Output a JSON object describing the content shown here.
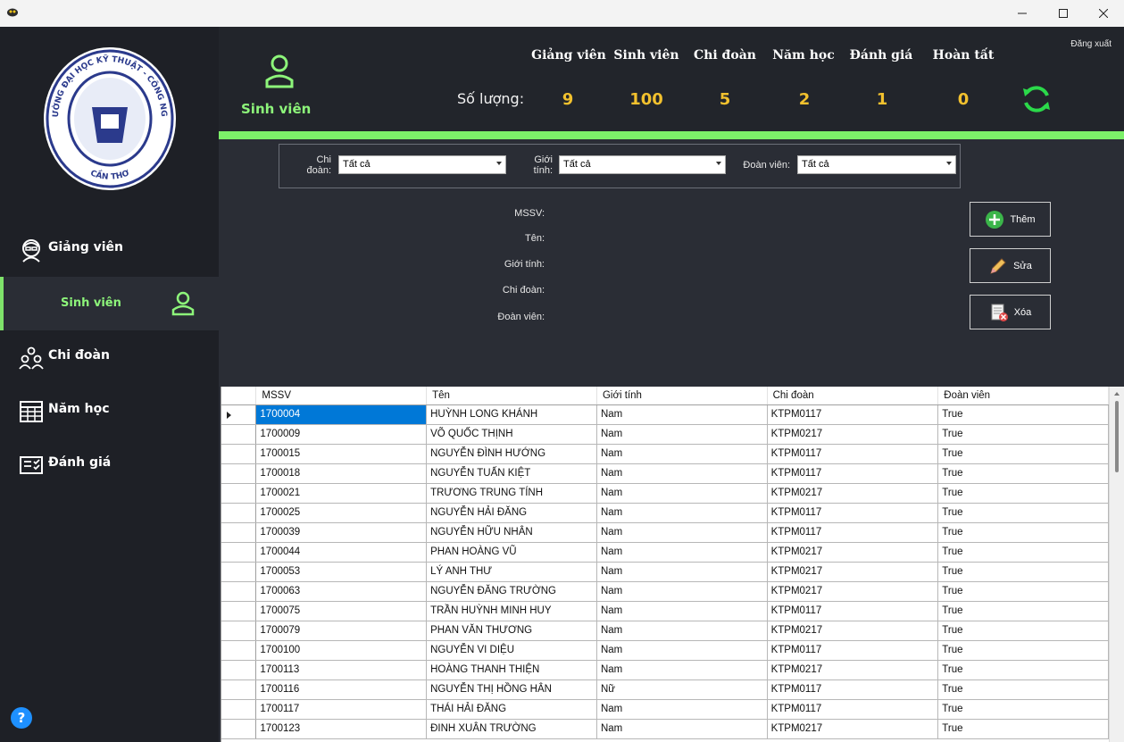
{
  "window": {
    "controls": {
      "minimize": "—",
      "maximize": "☐",
      "close": "✕"
    }
  },
  "sidebar": {
    "logo": {
      "text_top": "TRƯỜNG ĐẠI HỌC KỸ THUẬT - CÔNG NGHỆ",
      "text_bottom": "CẦN THƠ",
      "mark": "CTUT"
    },
    "items": [
      {
        "label": "Giảng viên",
        "icon": "teacher-icon",
        "active": false
      },
      {
        "label": "Sinh viên",
        "icon": "student-icon",
        "active": true
      },
      {
        "label": "Chi đoàn",
        "icon": "group-icon",
        "active": false
      },
      {
        "label": "Năm học",
        "icon": "table-icon",
        "active": false
      },
      {
        "label": "Đánh giá",
        "icon": "checklist-icon",
        "active": false
      }
    ],
    "help": "?"
  },
  "header": {
    "title": "Sinh viên",
    "logout": "Đăng xuất",
    "quantity_label": "Số lượng:",
    "stats": [
      {
        "label": "Giảng viên",
        "value": "9"
      },
      {
        "label": "Sinh viên",
        "value": "100"
      },
      {
        "label": "Chi đoàn",
        "value": "5"
      },
      {
        "label": "Năm học",
        "value": "2"
      },
      {
        "label": "Đánh giá",
        "value": "1"
      },
      {
        "label": "Hoàn tất",
        "value": "0"
      }
    ]
  },
  "filters": {
    "chi_doan_label_1": "Chi",
    "chi_doan_label_2": "đoàn:",
    "chi_doan_value": "Tất cả",
    "gioi_tinh_label_1": "Giới",
    "gioi_tinh_label_2": "tính:",
    "gioi_tinh_value": "Tất cả",
    "doan_vien_label": "Đoàn viên:",
    "doan_vien_value": "Tất cả"
  },
  "details": {
    "mssv": "MSSV:",
    "ten": "Tên:",
    "gioi_tinh": "Giới tính:",
    "chi_doan": "Chi đoàn:",
    "doan_vien": "Đoàn viên:"
  },
  "actions": {
    "add": "Thêm",
    "edit": "Sửa",
    "delete": "Xóa"
  },
  "table": {
    "columns": [
      "MSSV",
      "Tên",
      "Giới tính",
      "Chi đoàn",
      "Đoàn viên"
    ],
    "rows": [
      [
        "1700004",
        "HUỲNH LONG KHÁNH",
        "Nam",
        "KTPM0117",
        "True"
      ],
      [
        "1700009",
        "VÕ QUỐC THỊNH",
        "Nam",
        "KTPM0217",
        "True"
      ],
      [
        "1700015",
        "NGUYỄN ĐÌNH HƯỚNG",
        "Nam",
        "KTPM0117",
        "True"
      ],
      [
        "1700018",
        "NGUYỄN TUẤN KIỆT",
        "Nam",
        "KTPM0117",
        "True"
      ],
      [
        "1700021",
        "TRƯƠNG TRUNG TÍNH",
        "Nam",
        "KTPM0217",
        "True"
      ],
      [
        "1700025",
        "NGUYỄN HẢI ĐĂNG",
        "Nam",
        "KTPM0117",
        "True"
      ],
      [
        "1700039",
        "NGUYỄN HỮU NHÂN",
        "Nam",
        "KTPM0117",
        "True"
      ],
      [
        "1700044",
        "PHAN HOÀNG VŨ",
        "Nam",
        "KTPM0217",
        "True"
      ],
      [
        "1700053",
        "LÝ ANH THƯ",
        "Nam",
        "KTPM0217",
        "True"
      ],
      [
        "1700063",
        "NGUYỄN ĐĂNG TRƯỜNG",
        "Nam",
        "KTPM0217",
        "True"
      ],
      [
        "1700075",
        "TRẦN HUỲNH MINH HUY",
        "Nam",
        "KTPM0117",
        "True"
      ],
      [
        "1700079",
        "PHAN VĂN THƯƠNG",
        "Nam",
        "KTPM0217",
        "True"
      ],
      [
        "1700100",
        "NGUYỄN VI DIỆU",
        "Nam",
        "KTPM0117",
        "True"
      ],
      [
        "1700113",
        "HOÀNG THANH THIỆN",
        "Nam",
        "KTPM0217",
        "True"
      ],
      [
        "1700116",
        "NGUYỄN THỊ HỒNG HÂN",
        "Nữ",
        "KTPM0117",
        "True"
      ],
      [
        "1700117",
        "THÁI HẢI ĐĂNG",
        "Nam",
        "KTPM0117",
        "True"
      ],
      [
        "1700123",
        "ĐINH XUÂN TRƯỜNG",
        "Nam",
        "KTPM0217",
        "True"
      ]
    ],
    "selected_row": 0
  },
  "colors": {
    "accent_green": "#7cf069",
    "stat_yellow": "#f2c12e",
    "selection_blue": "#0078d7"
  }
}
